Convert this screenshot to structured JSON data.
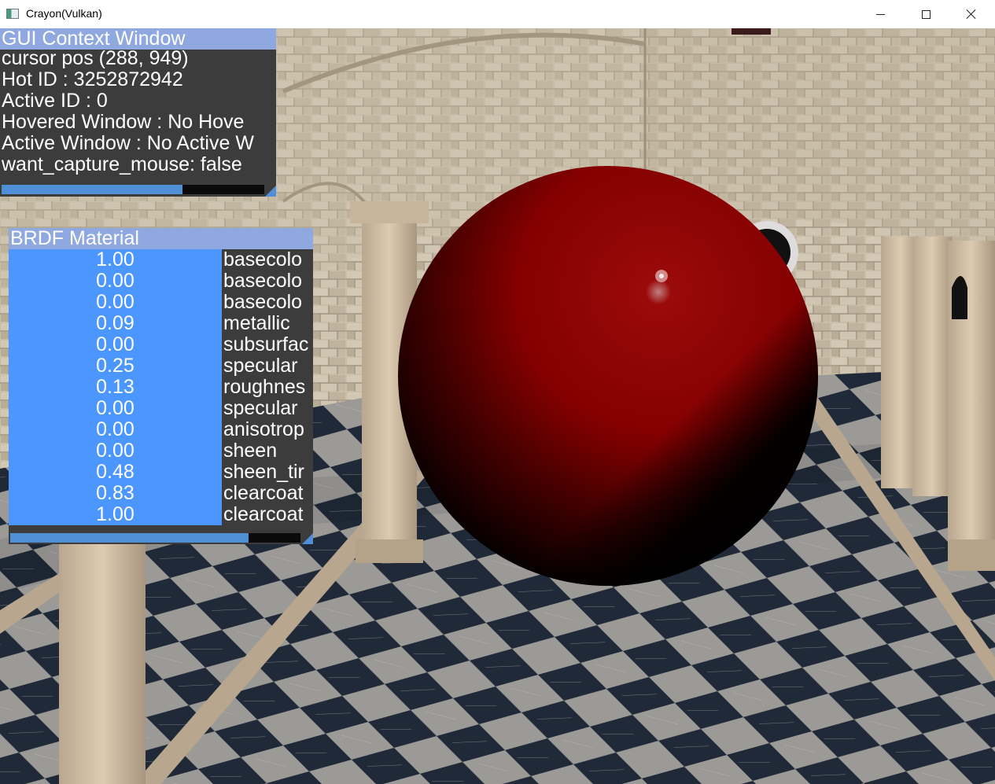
{
  "window": {
    "title": "Crayon(Vulkan)",
    "minimize_icon": "minimize-icon",
    "maximize_icon": "maximize-icon",
    "close_icon": "close-icon"
  },
  "context_window": {
    "title": "GUI Context Window",
    "lines": [
      "cursor pos (288, 949)",
      "Hot ID : 3252872942",
      "Active ID : 0",
      "Hovered Window : No Hove",
      "Active Window : No Active W",
      "want_capture_mouse: false"
    ],
    "scroll_fraction": 0.69
  },
  "brdf_window": {
    "title": "BRDF Material",
    "params": [
      {
        "value": "1.00",
        "label": "basecolo"
      },
      {
        "value": "0.00",
        "label": "basecolo"
      },
      {
        "value": "0.00",
        "label": "basecolo"
      },
      {
        "value": "0.09",
        "label": "metallic"
      },
      {
        "value": "0.00",
        "label": "subsurfac"
      },
      {
        "value": "0.25",
        "label": "specular"
      },
      {
        "value": "0.13",
        "label": "roughnes"
      },
      {
        "value": "0.00",
        "label": "specular"
      },
      {
        "value": "0.00",
        "label": "anisotrop"
      },
      {
        "value": "0.00",
        "label": "sheen"
      },
      {
        "value": "0.48",
        "label": "sheen_tir"
      },
      {
        "value": "0.83",
        "label": "clearcoat"
      },
      {
        "value": "1.00",
        "label": "clearcoat"
      }
    ],
    "scroll_fraction": 0.82
  },
  "scene": {
    "sphere_color": "#8c0000",
    "floor_dark": "#1e2836",
    "floor_light": "#9a9a98",
    "wall_color": "#c8bda9"
  }
}
